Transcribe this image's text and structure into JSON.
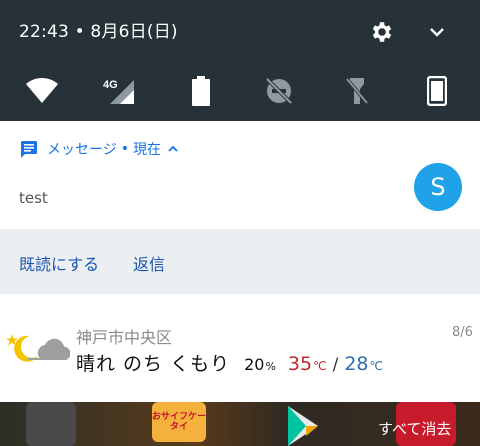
{
  "status": {
    "time_date": "22:43 • 8月6日(日)",
    "icons": [
      "gear-icon",
      "chevron-down-icon"
    ]
  },
  "quick_tiles": [
    {
      "name": "wifi",
      "icon": "wifi-icon"
    },
    {
      "name": "mobile-data",
      "icon": "signal-4g-icon",
      "label": "4G"
    },
    {
      "name": "battery",
      "icon": "battery-icon"
    },
    {
      "name": "do-not-disturb",
      "icon": "dnd-off-icon"
    },
    {
      "name": "flashlight",
      "icon": "flashlight-off-icon"
    },
    {
      "name": "auto-rotate",
      "icon": "phone-portrait-icon"
    }
  ],
  "message_notification": {
    "app_name": "メッセージ",
    "separator": "•",
    "time": "現在",
    "text": "test",
    "avatar_letter": "S",
    "avatar_color": "#1fa2e8",
    "actions": {
      "mark_read": "既読にする",
      "reply": "返信"
    }
  },
  "weather_notification": {
    "city": "神戸市中央区",
    "date": "8/6",
    "forecast": "晴れ のち くもり",
    "precip": "20",
    "precip_unit": "%",
    "high": "35",
    "high_unit": "℃",
    "slash": "/",
    "low": "28",
    "low_unit": "℃",
    "high_color": "#c0292f",
    "low_color": "#2d6fb0"
  },
  "home": {
    "yellow_app_text": "おサイフケータイ",
    "clear_all": "すべて消去"
  }
}
